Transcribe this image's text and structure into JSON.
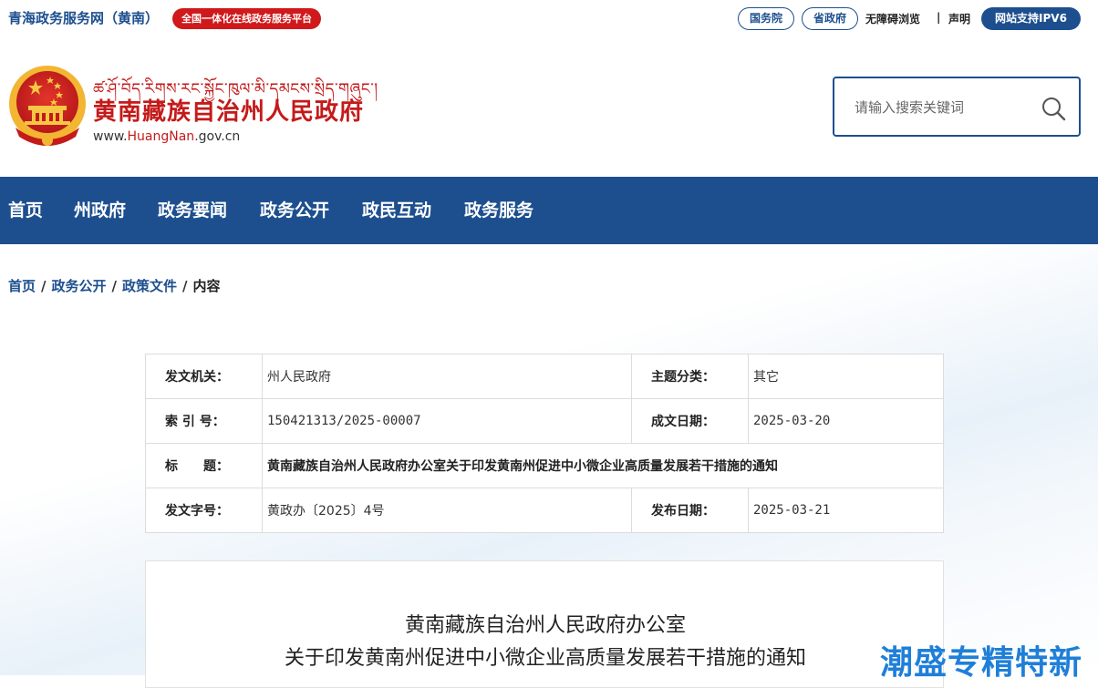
{
  "topbar": {
    "site_name": "青海政务服务网（黄南）",
    "platform_badge": "全国一体化在线政务服务平台",
    "guowuyuan": "国务院",
    "shengzhengfu": "省政府",
    "accessible": "无障碍浏览",
    "separator": "|",
    "declaration": "声明",
    "ipv6": "网站支持IPV6"
  },
  "header": {
    "tibetan_name": "ཚ་ཤོ་བོད་རིགས་རང་སྐྱོང་ཁུལ་མི་དམངས་སྲིད་གཞུང་།",
    "gov_name": "黄南藏族自治州人民政府",
    "domain_prefix": "www.",
    "domain_highlight": "HuangNan",
    "domain_suffix": ".gov.cn"
  },
  "search": {
    "placeholder": "请输入搜索关键词"
  },
  "nav": {
    "items": [
      {
        "label": "首页"
      },
      {
        "label": "州政府"
      },
      {
        "label": "政务要闻"
      },
      {
        "label": "政务公开"
      },
      {
        "label": "政民互动"
      },
      {
        "label": "政务服务"
      }
    ]
  },
  "breadcrumb": {
    "home": "首页",
    "level1": "政务公开",
    "level2": "政策文件",
    "current": "内容",
    "sep": "/"
  },
  "meta": {
    "issuer_label": "发文机关：",
    "issuer_value": "州人民政府",
    "topic_label": "主题分类：",
    "topic_value": "其它",
    "index_label": "索 引 号：",
    "index_value": "150421313/2025-00007",
    "created_label": "成文日期：",
    "created_value": "2025-03-20",
    "title_label": "标　　题：",
    "title_value": "黄南藏族自治州人民政府办公室关于印发黄南州促进中小微企业高质量发展若干措施的通知",
    "docno_label": "发文字号：",
    "docno_value": "黄政办〔2025〕4号",
    "published_label": "发布日期：",
    "published_value": "2025-03-21"
  },
  "document": {
    "title_line1": "黄南藏族自治州人民政府办公室",
    "title_line2": "关于印发黄南州促进中小微企业高质量发展若干措施的通知"
  },
  "watermark": {
    "text": "潮盛专精特新"
  },
  "colors": {
    "primary_blue": "#1d4f8f",
    "red": "#c41a1a",
    "badge_red": "#d0191b"
  }
}
